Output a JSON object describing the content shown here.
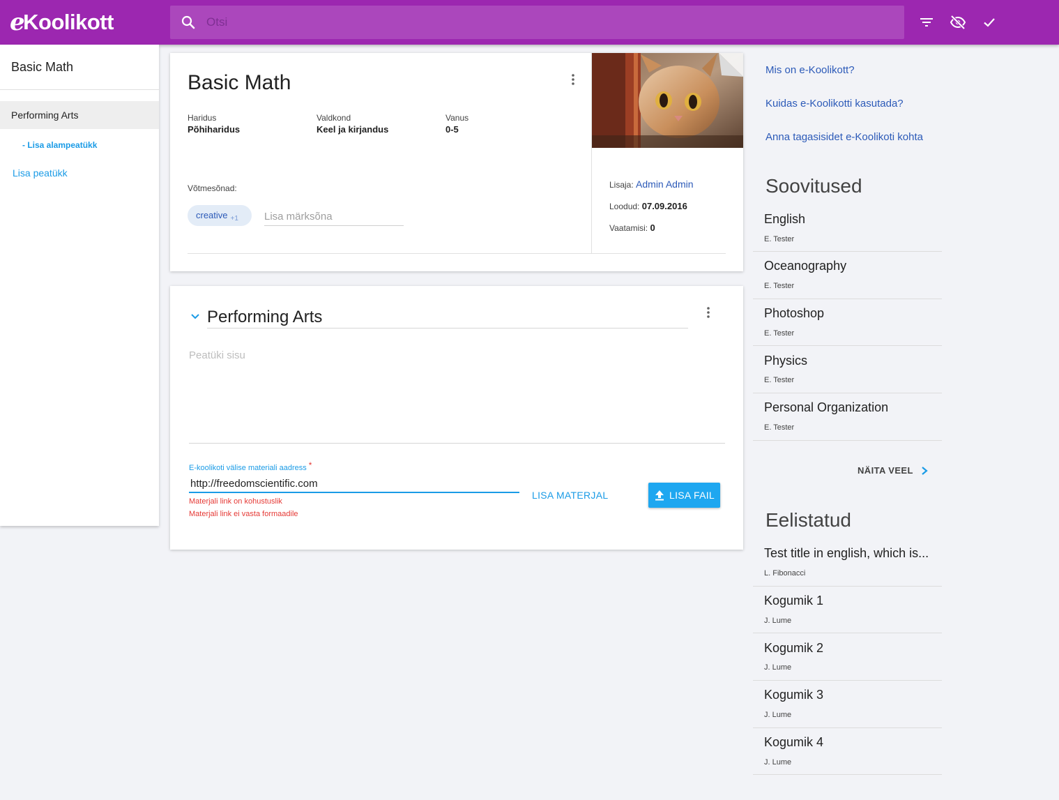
{
  "header": {
    "logo_text": "Koolikott",
    "logo_prefix": "e",
    "search_placeholder": "Otsi",
    "icons": [
      "search-icon",
      "filter-icon",
      "visibility-off-icon",
      "check-icon"
    ]
  },
  "sidebar": {
    "title": "Basic Math",
    "active_item": "Performing Arts",
    "add_subchapter": "- Lisa alampeatükk",
    "add_chapter": "Lisa peatükk"
  },
  "material": {
    "title": "Basic Math",
    "meta": [
      {
        "label": "Haridus",
        "value": "Põhiharidus"
      },
      {
        "label": "Valdkond",
        "value": "Keel ja kirjandus"
      },
      {
        "label": "Vanus",
        "value": "0-5"
      }
    ],
    "keywords_label": "Võtmesõnad:",
    "keyword_chip": "creative",
    "keyword_chip_count": "+1",
    "keyword_placeholder": "Lisa märksõna",
    "author_label": "Lisaja:",
    "author_name": "Admin Admin",
    "created_label": "Loodud:",
    "created_value": "07.09.2016",
    "views_label": "Vaatamisi:",
    "views_value": "0",
    "image_subject": "cat peeking"
  },
  "chapter": {
    "title": "Performing Arts",
    "content_placeholder": "Peatüki sisu",
    "url_label": "E-koolikoti välise materiali aadress",
    "url_required_mark": "*",
    "url_value": "http://freedomscientific.com",
    "errors": [
      "Materjali link on kohustuslik",
      "Materjali link ei vasta formaadile"
    ],
    "add_material_button": "LISA MATERJAL",
    "add_file_button": "LISA FAIL"
  },
  "right": {
    "links": [
      "Mis on e-Koolikott?",
      "Kuidas e-Koolikotti kasutada?",
      "Anna tagasisidet e-Koolikoti kohta"
    ],
    "recommendations_heading": "Soovitused",
    "recommendations": [
      {
        "title": "English",
        "author": "E. Tester"
      },
      {
        "title": "Oceanography",
        "author": "E. Tester"
      },
      {
        "title": "Photoshop",
        "author": "E. Tester"
      },
      {
        "title": "Physics",
        "author": "E. Tester"
      },
      {
        "title": "Personal Organization",
        "author": "E. Tester"
      }
    ],
    "show_more": "NÄITA VEEL",
    "featured_heading": "Eelistatud",
    "featured": [
      {
        "title": "Test title in english, which is...",
        "author": "L. Fibonacci"
      },
      {
        "title": "Kogumik 1",
        "author": "J. Lume"
      },
      {
        "title": "Kogumik 2",
        "author": "J. Lume"
      },
      {
        "title": "Kogumik 3",
        "author": "J. Lume"
      },
      {
        "title": "Kogumik 4",
        "author": "J. Lume"
      }
    ]
  },
  "colors": {
    "primary": "#9c27b0",
    "search_bg": "#ab47bc",
    "accent": "#1a9be6",
    "link": "#2c5ab8",
    "error": "#e53935"
  }
}
